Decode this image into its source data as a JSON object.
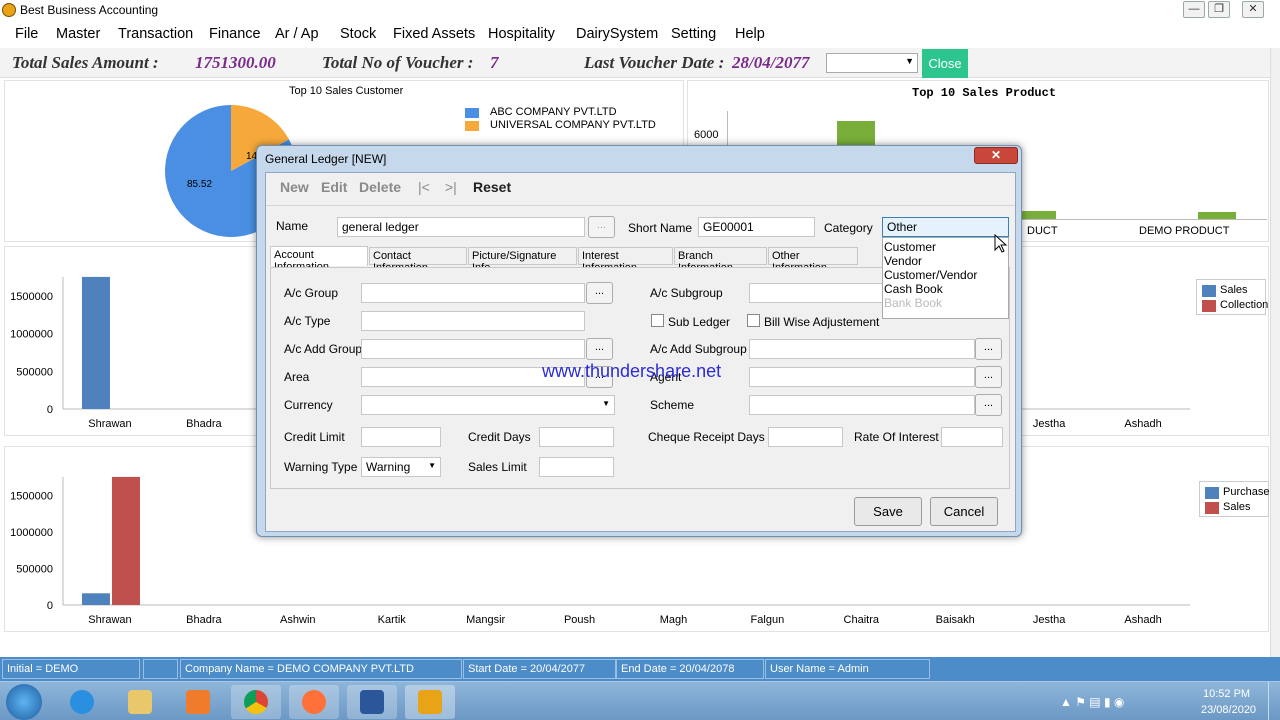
{
  "window": {
    "title": "Best Business Accounting",
    "buttons": [
      "—",
      "❐",
      "✕"
    ]
  },
  "menu": [
    "File",
    "Master",
    "Transaction",
    "Finance",
    "Ar / Ap",
    "Stock",
    "Fixed Assets",
    "Hospitality",
    "DairySystem",
    "Setting",
    "Help"
  ],
  "stats": {
    "total_sales_label": "Total Sales Amount :",
    "total_sales_value": "1751300.00",
    "total_voucher_label": "Total No of Voucher :",
    "total_voucher_value": "7",
    "last_date_label": "Last Voucher Date :",
    "last_date_value": "28/04/2077",
    "close_label": "Close"
  },
  "top_customer_chart": {
    "title": "Top 10 Sales Customer",
    "legend": [
      "ABC COMPANY PVT.LTD",
      "UNIVERSAL COMPANY PVT.LTD"
    ],
    "slice_labels": [
      "85.52",
      "14"
    ],
    "colors": [
      "#4a8fe3",
      "#f6a93a"
    ]
  },
  "top_product_chart": {
    "title": "Top 10 Sales Product",
    "ytick": "6000",
    "xlabels": [
      "DUCT",
      "DEMO PRODUCT"
    ]
  },
  "chart_data": [
    {
      "type": "pie",
      "title": "Top 10 Sales Customer",
      "labels": [
        "ABC COMPANY PVT.LTD",
        "UNIVERSAL COMPANY PVT.LTD"
      ],
      "values": [
        85.52,
        14.48
      ]
    },
    {
      "type": "bar",
      "categories": [
        "Shrawan",
        "Bhadra",
        "Ashwin",
        "Kartik",
        "Mangsir",
        "Poush",
        "Magh",
        "Falgun",
        "Chaitra",
        "Baisakh",
        "Jestha",
        "Ashadh"
      ],
      "series": [
        {
          "name": "Sales",
          "color": "#4f81bd",
          "values": [
            1751300,
            0,
            0,
            0,
            0,
            0,
            0,
            0,
            0,
            0,
            0,
            0
          ]
        },
        {
          "name": "Collection",
          "color": "#c0504d",
          "values": [
            0,
            0,
            0,
            0,
            0,
            0,
            0,
            0,
            0,
            0,
            0,
            0
          ]
        }
      ],
      "ylim": [
        0,
        1750000
      ],
      "yticks": [
        "1500000",
        "1000000",
        "500000",
        "0"
      ]
    },
    {
      "type": "bar",
      "categories": [
        "Shrawan",
        "Bhadra",
        "Ashwin",
        "Kartik",
        "Mangsir",
        "Poush",
        "Magh",
        "Falgun",
        "Chaitra",
        "Baisakh",
        "Jestha",
        "Ashadh"
      ],
      "series": [
        {
          "name": "Purchase",
          "color": "#4f81bd",
          "values": [
            160000,
            0,
            0,
            0,
            0,
            0,
            0,
            0,
            0,
            0,
            0,
            0
          ]
        },
        {
          "name": "Sales",
          "color": "#c0504d",
          "values": [
            1751300,
            0,
            0,
            0,
            0,
            0,
            0,
            0,
            0,
            0,
            0,
            0
          ]
        }
      ],
      "ylim": [
        0,
        1750000
      ],
      "yticks": [
        "1500000",
        "1000000",
        "500000",
        "0"
      ]
    }
  ],
  "dialog": {
    "title": "General Ledger [NEW]",
    "toolbar": [
      "New",
      "Edit",
      "Delete",
      "|<",
      ">|",
      "Reset"
    ],
    "name_label": "Name",
    "name_value": "general ledger",
    "short_name_label": "Short Name",
    "short_name_value": "GE00001",
    "category_label": "Category",
    "category_value": "Other",
    "category_options": [
      "Customer",
      "Vendor",
      "Customer/Vendor",
      "Cash Book",
      "Bank Book"
    ],
    "tabs": [
      "Account Information",
      "Contact Information",
      "Picture/Signature Info",
      "Interest Information",
      "Branch Information",
      "Other Information"
    ],
    "fields": {
      "ac_group": "A/c Group",
      "ac_type": "A/c Type",
      "ac_add_group": "A/c Add Group",
      "area": "Area",
      "currency": "Currency",
      "ac_subgroup": "A/c Subgroup",
      "sub_ledger": "Sub Ledger",
      "bill_wise": "Bill Wise Adjustement",
      "ac_add_subgroup": "A/c Add Subgroup",
      "agent": "Agent",
      "scheme": "Scheme",
      "credit_limit": "Credit Limit",
      "credit_days": "Credit Days",
      "cheque_days": "Cheque Receipt Days",
      "rate_interest": "Rate Of Interest",
      "warning_type": "Warning Type",
      "warning_value": "Warning",
      "sales_limit": "Sales Limit"
    },
    "dot_button": "...",
    "save_label": "Save",
    "cancel_label": "Cancel"
  },
  "watermark": "www.thundershare.net",
  "statusbar": {
    "initial": "Initial =   DEMO",
    "company": "Company Name =   DEMO COMPANY PVT.LTD",
    "start_date": "Start Date =   20/04/2077",
    "end_date": "End Date =   20/04/2078",
    "user": "User Name =   Admin"
  },
  "taskbar": {
    "time": "10:52 PM",
    "date": "23/08/2020"
  }
}
